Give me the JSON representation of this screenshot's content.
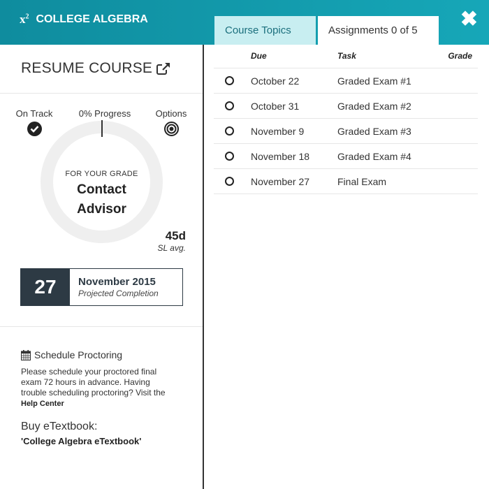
{
  "header": {
    "logo_symbol": "x",
    "logo_sup": "2",
    "title": "COLLEGE ALGEBRA",
    "close_icon": "close-icon"
  },
  "tabs": [
    {
      "label": "Course Topics",
      "active": false
    },
    {
      "label": "Assignments 0 of 5",
      "active": true
    }
  ],
  "sidebar": {
    "resume_label": "RESUME COURSE",
    "stats": {
      "on_track": "On Track",
      "progress": "0% Progress",
      "options": "Options"
    },
    "ring": {
      "caption": "FOR YOUR GRADE",
      "line1": "Contact",
      "line2": "Advisor"
    },
    "sl": {
      "value": "45d",
      "label": "SL avg."
    },
    "completion": {
      "day": "27",
      "month_year": "November 2015",
      "label": "Projected Completion"
    },
    "schedule": {
      "title": "Schedule Proctoring",
      "text": "Please schedule your proctored final exam 72 hours in advance. Having trouble scheduling proctoring? Visit the",
      "link": "Help Center"
    },
    "buy": {
      "label": "Buy eTextbook:",
      "link": "'College Algebra eTextbook'"
    }
  },
  "assignments": {
    "columns": {
      "due": "Due",
      "task": "Task",
      "grade": "Grade"
    },
    "rows": [
      {
        "due": "October 22",
        "task": "Graded Exam #1",
        "grade": ""
      },
      {
        "due": "October 31",
        "task": "Graded Exam #2",
        "grade": ""
      },
      {
        "due": "November 9",
        "task": "Graded Exam #3",
        "grade": ""
      },
      {
        "due": "November 18",
        "task": "Graded Exam #4",
        "grade": ""
      },
      {
        "due": "November 27",
        "task": "Final Exam",
        "grade": ""
      }
    ]
  },
  "colors": {
    "header": "#16a7b8",
    "tab_inactive": "#c8eef1",
    "dark": "#2d3a44"
  }
}
